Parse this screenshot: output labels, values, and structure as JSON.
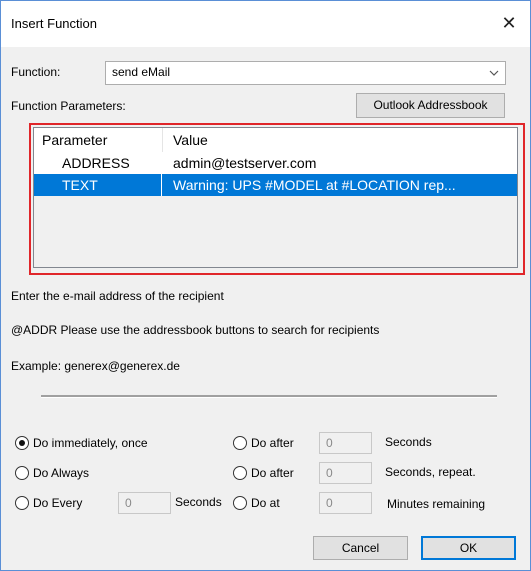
{
  "window": {
    "title": "Insert Function",
    "close_glyph": "✕"
  },
  "function": {
    "label": "Function:",
    "value": "send eMail"
  },
  "params_label": "Function Parameters:",
  "outlook_button": "Outlook Addressbook",
  "grid": {
    "headers": [
      "Parameter",
      "Value"
    ],
    "rows": [
      {
        "param": "ADDRESS",
        "value": "admin@testserver.com",
        "selected": false
      },
      {
        "param": "TEXT",
        "value": "Warning: UPS #MODEL at #LOCATION rep...",
        "selected": true
      }
    ]
  },
  "help": {
    "line1": "Enter the e-mail address of the recipient",
    "line2": "@ADDR  Please use the addressbook buttons to search for recipients",
    "line3": "Example: generex@generex.de"
  },
  "options": {
    "immediately": "Do immediately, once",
    "always": "Do Always",
    "every": "Do Every",
    "every_value": "0",
    "every_unit": "Seconds",
    "after1": "Do after",
    "after1_value": "0",
    "after1_unit": "Seconds",
    "after2": "Do after",
    "after2_value": "0",
    "after2_unit": "Seconds, repeat.",
    "at": "Do at",
    "at_value": "0",
    "at_unit": "Minutes remaining",
    "selected": "immediately"
  },
  "buttons": {
    "cancel": "Cancel",
    "ok": "OK"
  },
  "colors": {
    "selection": "#0078d7",
    "highlight_border": "#e0262a"
  }
}
